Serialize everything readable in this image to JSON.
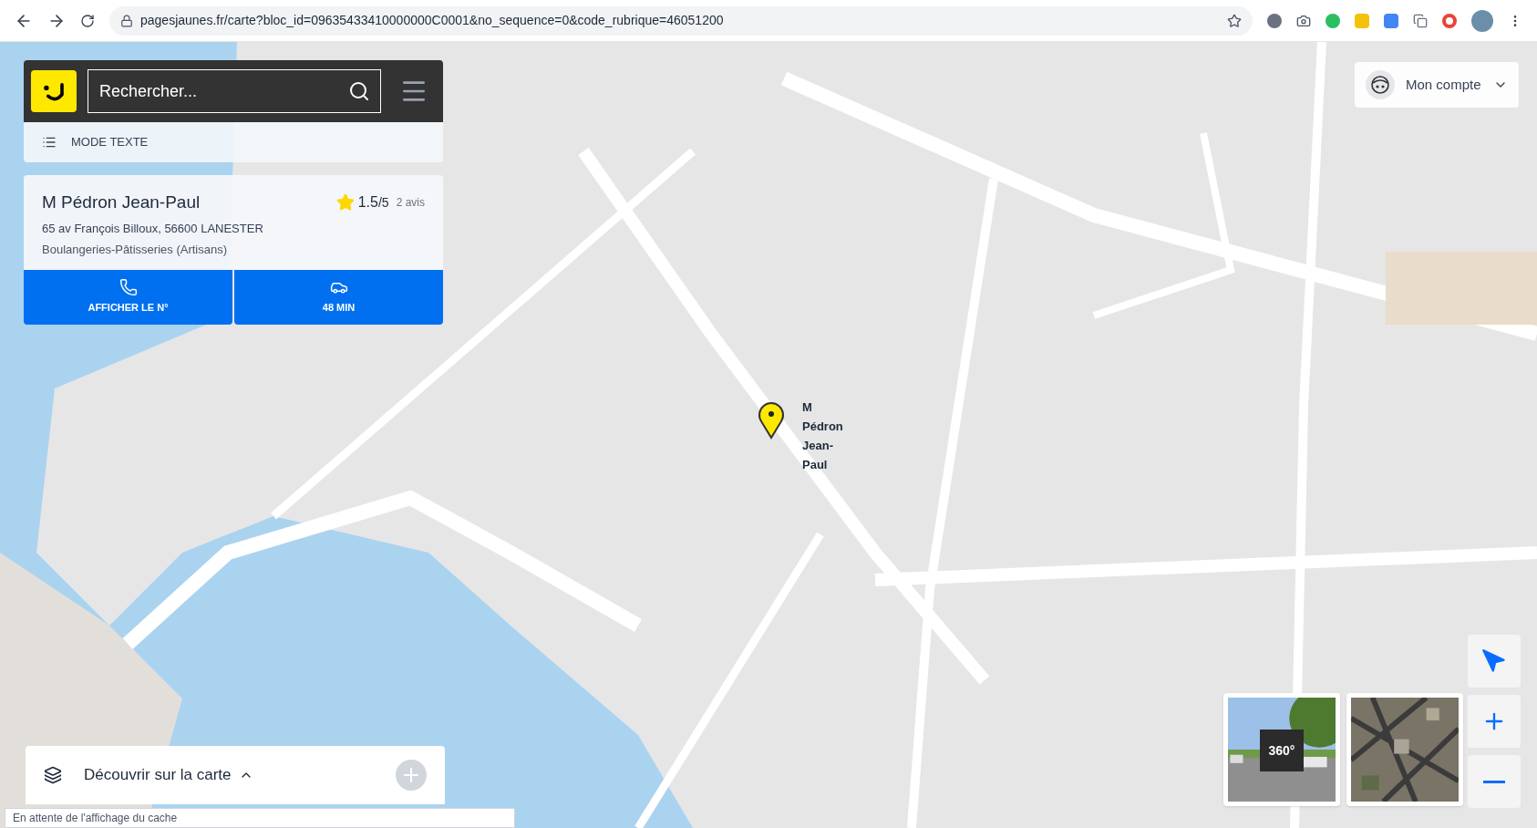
{
  "browser": {
    "url": "pagesjaunes.fr/carte?bloc_id=09635433410000000C0001&no_sequence=0&code_rubrique=46051200",
    "status": "En attente de l'affichage du cache"
  },
  "search": {
    "placeholder": "Rechercher..."
  },
  "mode_link": "MODE TEXTE",
  "listing": {
    "name": "M Pédron Jean-Paul",
    "address": "65 av François Billoux, 56600 LANESTER",
    "category": "Boulangeries-Pâtisseries (Artisans)",
    "rating": "1.5",
    "scale": "/5",
    "reviews": "2 avis"
  },
  "actions": [
    {
      "kind": "phone",
      "label": "AFFICHER LE N°"
    },
    {
      "kind": "car",
      "label": "48 MIN"
    }
  ],
  "account": {
    "label": "Mon compte"
  },
  "marker": {
    "label": "M Pédron Jean-Paul"
  },
  "discover": {
    "label": "Découvrir sur la carte"
  },
  "thumbnails": [
    {
      "kind": "street_view",
      "badge": "360°"
    },
    {
      "kind": "satellite"
    }
  ]
}
